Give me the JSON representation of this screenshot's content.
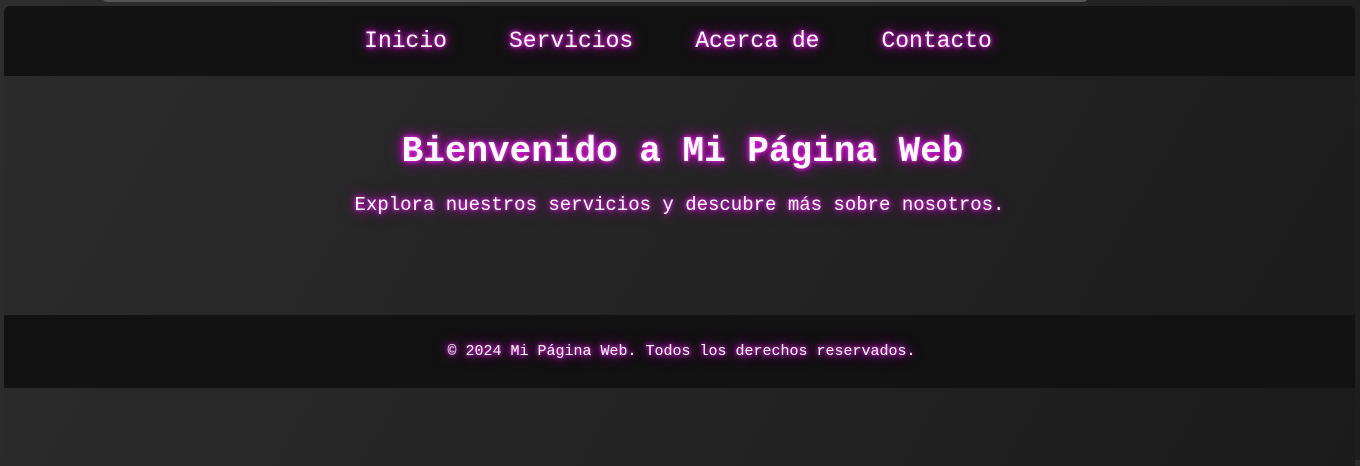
{
  "nav": {
    "items": [
      {
        "label": "Inicio"
      },
      {
        "label": "Servicios"
      },
      {
        "label": "Acerca de"
      },
      {
        "label": "Contacto"
      }
    ]
  },
  "hero": {
    "title": "Bienvenido a Mi Página Web",
    "subtitle": "Explora nuestros servicios y descubre más sobre nosotros."
  },
  "footer": {
    "text": "© 2024 Mi Página Web. Todos los derechos reservados."
  },
  "colors": {
    "glow": "#d000d0",
    "text": "#ffffff",
    "bar_background": "#121212",
    "body_background": "#2a2a2a"
  }
}
